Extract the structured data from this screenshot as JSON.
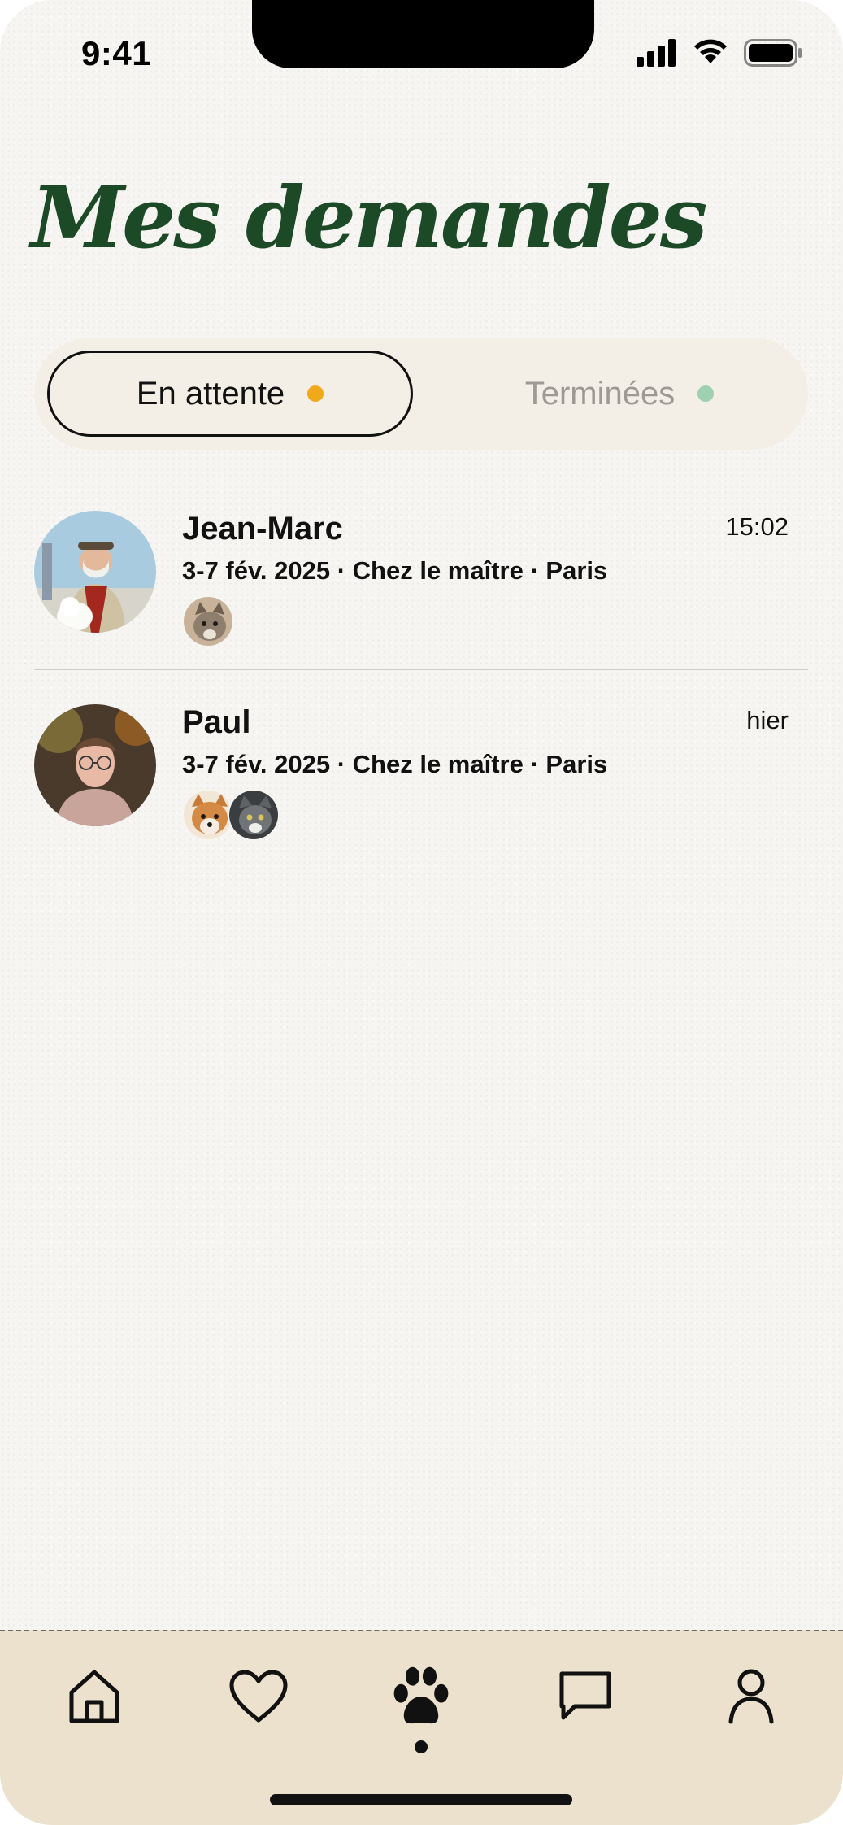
{
  "status_bar": {
    "time": "9:41"
  },
  "page": {
    "title": "Mes demandes"
  },
  "tabs": [
    {
      "label": "En attente",
      "active": true,
      "dot_color": "#f0a91a"
    },
    {
      "label": "Terminées",
      "active": false,
      "dot_color": "#9fd0b0"
    }
  ],
  "requests": [
    {
      "name": "Jean-Marc",
      "meta": "3-7 fév. 2025 · Chez le maître · Paris",
      "time": "15:02",
      "pets": [
        "cat-tabby"
      ]
    },
    {
      "name": "Paul",
      "meta": "3-7 fév. 2025 · Chez le maître · Paris",
      "time": "hier",
      "pets": [
        "dog-shiba",
        "cat-grey"
      ]
    }
  ],
  "tabbar": {
    "items": [
      "home-icon",
      "heart-icon",
      "paw-icon",
      "chat-icon",
      "profile-icon"
    ],
    "active": "paw-icon"
  },
  "colors": {
    "title": "#1c4a26",
    "tabbar_bg": "#ece1cc",
    "segment_bg": "#f4efe6"
  }
}
